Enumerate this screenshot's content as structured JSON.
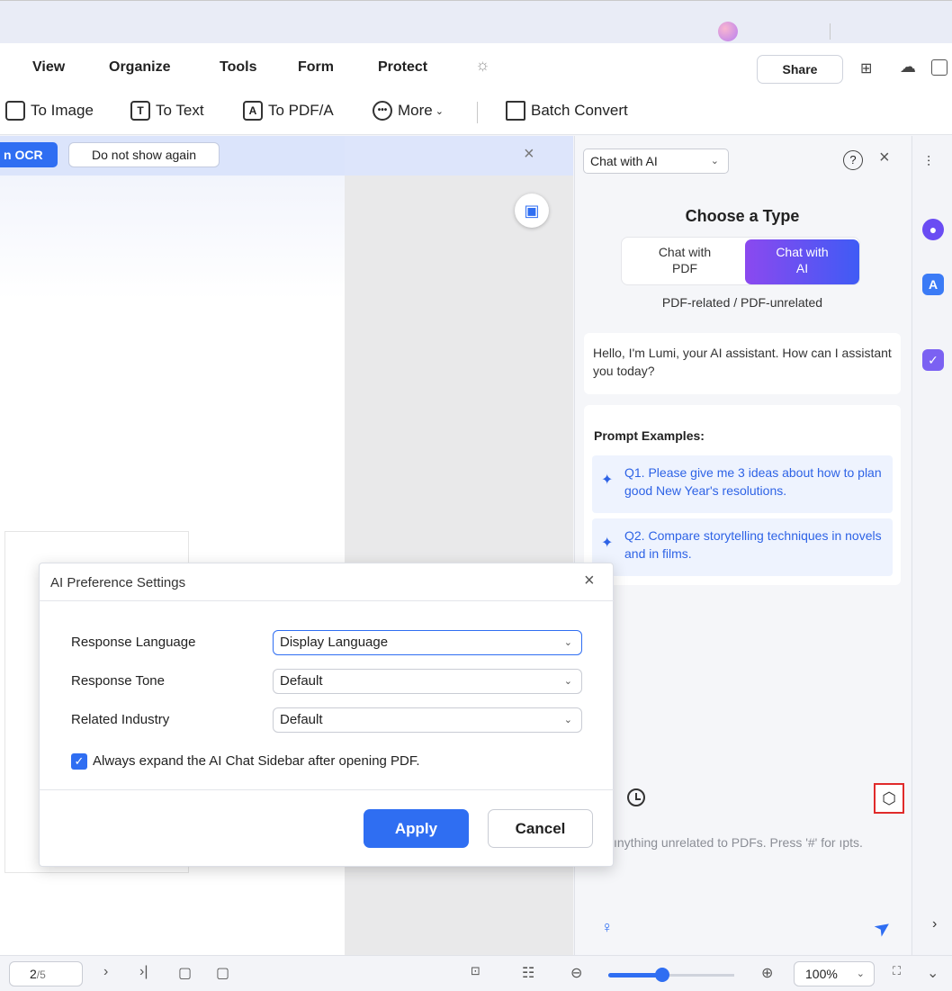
{
  "window": {
    "minimize_glyph": "—",
    "restore_glyph": "❐",
    "close_glyph": "×",
    "more_glyph": "⋮",
    "feedback_glyph": "▭"
  },
  "menu": {
    "items": [
      "View",
      "Organize",
      "Tools",
      "Form",
      "Protect"
    ],
    "share_label": "Share"
  },
  "toolbar": {
    "to_image": "To Image",
    "to_text": "To Text",
    "to_pdfa": "To PDF/A",
    "more": "More",
    "batch_convert": "Batch Convert",
    "to_text_icon": "T",
    "to_pdfa_icon": "A"
  },
  "ocr_banner": {
    "action_label": "n OCR",
    "dismiss_label": "Do not show again"
  },
  "ai_panel": {
    "mode_select": "Chat with AI",
    "choose_title": "Choose a Type",
    "type_pdf": "Chat with PDF",
    "type_ai": "Chat with AI",
    "type_subtitle": "PDF-related / PDF-unrelated",
    "greeting": "Hello, I'm Lumi, your AI assistant. How can I assistant you today?",
    "prompts_title": "Prompt Examples:",
    "prompts": [
      "Q1. Please give me 3 ideas about how to plan good New Year's resolutions.",
      "Q2. Compare storytelling techniques in novels and in films."
    ],
    "input_placeholder": "ınything unrelated to PDFs. Press '#' for ıpts.",
    "help_glyph": "?",
    "close_glyph": "×"
  },
  "dialog": {
    "title": "AI Preference Settings",
    "fields": [
      {
        "label": "Response Language",
        "value": "Display Language"
      },
      {
        "label": "Response Tone",
        "value": "Default"
      },
      {
        "label": "Related Industry",
        "value": "Default"
      }
    ],
    "checkbox_label": "Always expand the AI Chat Sidebar after opening PDF.",
    "checkbox_checked": true,
    "apply_label": "Apply",
    "cancel_label": "Cancel"
  },
  "statusbar": {
    "current_page": "2",
    "total_pages": "/5",
    "zoom": "100%",
    "zoom_level_fraction": 0.43
  },
  "colors": {
    "accent": "#2f6ef2",
    "ai_gradient_start": "#8b49ef",
    "ai_gradient_end": "#3f5bf5",
    "highlight": "#e02b2b"
  }
}
